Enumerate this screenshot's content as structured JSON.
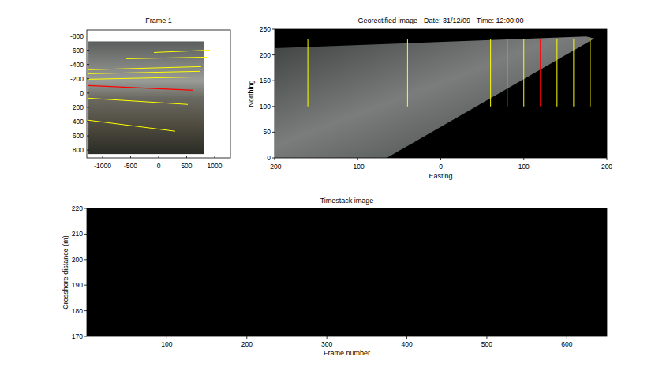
{
  "frame_axes": {
    "title": "Frame 1",
    "x_ticks": [
      "-1000",
      "-500",
      "0",
      "500",
      "1000"
    ],
    "y_ticks": [
      "-800",
      "-600",
      "-400",
      "-200",
      "0",
      "200",
      "400",
      "600",
      "800"
    ],
    "transects": [
      {
        "points": [
          -85,
          -568,
          901,
          -601
        ],
        "selected": false,
        "color": "#ffff00"
      },
      {
        "points": [
          -577,
          -480,
          859,
          -502
        ],
        "selected": false,
        "color": "#ffff00"
      },
      {
        "points": [
          -1253,
          -326,
          760,
          -370
        ],
        "selected": false,
        "color": "#ffff00"
      },
      {
        "points": [
          -1253,
          -270,
          732,
          -304
        ],
        "selected": false,
        "color": "#ffff00"
      },
      {
        "points": [
          -1253,
          -193,
          718,
          -226
        ],
        "selected": false,
        "color": "#ffff00"
      },
      {
        "points": [
          -1253,
          -105,
          620,
          -39
        ],
        "selected": true,
        "color": "#ff0000"
      },
      {
        "points": [
          -1253,
          72,
          521,
          160
        ],
        "selected": false,
        "color": "#ffff00"
      },
      {
        "points": [
          -1253,
          381,
          296,
          535
        ],
        "selected": false,
        "color": "#ffff00"
      }
    ]
  },
  "georectified_axes": {
    "title": "Georectified image - Date: 31/12/09 - Time: 12:00:00",
    "x_label": "Easting",
    "y_label": "Northing",
    "x_ticks": [
      "-200",
      "-100",
      "0",
      "100",
      "200"
    ],
    "y_ticks": [
      "0",
      "50",
      "100",
      "150",
      "200",
      "250"
    ],
    "transects": [
      {
        "easting": -160,
        "from": 100,
        "to": 230,
        "selected": false,
        "color": "#ffff00"
      },
      {
        "easting": -40,
        "from": 100,
        "to": 230,
        "selected": false,
        "color": "#ffff00"
      },
      {
        "easting": 60,
        "from": 100,
        "to": 230,
        "selected": false,
        "color": "#ffff00"
      },
      {
        "easting": 80,
        "from": 100,
        "to": 230,
        "selected": false,
        "color": "#ffff00"
      },
      {
        "easting": 100,
        "from": 100,
        "to": 230,
        "selected": false,
        "color": "#ffff00"
      },
      {
        "easting": 120,
        "from": 100,
        "to": 230,
        "selected": true,
        "color": "#ff0000"
      },
      {
        "easting": 140,
        "from": 100,
        "to": 230,
        "selected": false,
        "color": "#ffff00"
      },
      {
        "easting": 160,
        "from": 100,
        "to": 230,
        "selected": false,
        "color": "#ffff00"
      },
      {
        "easting": 180,
        "from": 100,
        "to": 230,
        "selected": false,
        "color": "#ffff00"
      }
    ]
  },
  "timestack_axes": {
    "title": "Timestack image",
    "x_label": "Frame number",
    "y_label": "Crosshore distance (m)",
    "x_ticks": [
      "100",
      "200",
      "300",
      "400",
      "500",
      "600"
    ],
    "y_ticks": [
      "170",
      "180",
      "190",
      "200",
      "210",
      "220"
    ]
  }
}
